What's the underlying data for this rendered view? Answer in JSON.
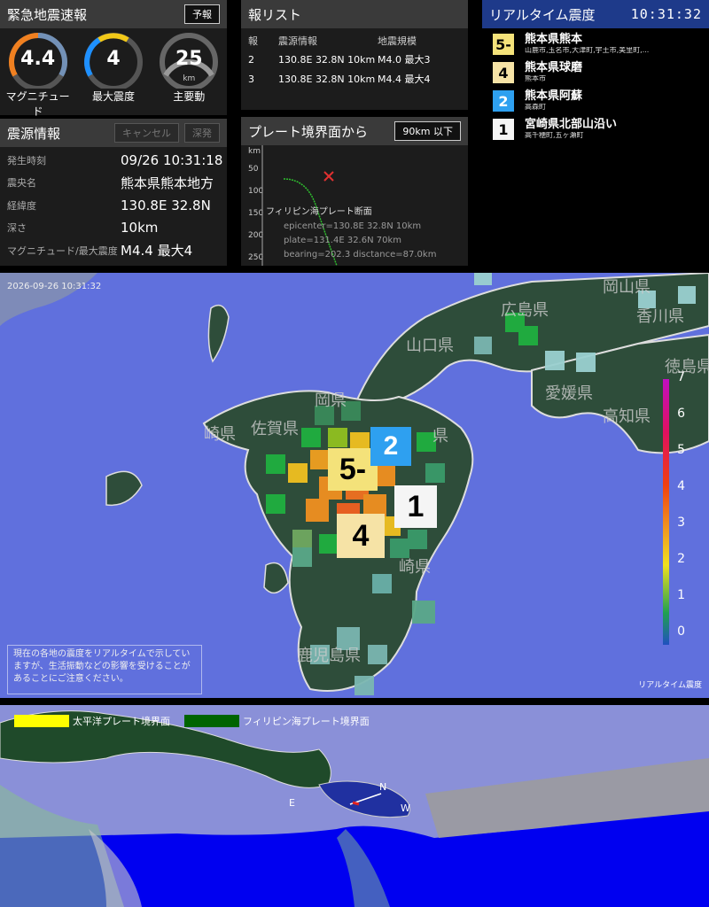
{
  "eew": {
    "title": "緊急地震速報",
    "forecast_button": "予報",
    "gauges": [
      {
        "value": "4.4",
        "unit": "",
        "label": "マグニチュード",
        "color": "#ffffff"
      },
      {
        "value": "4",
        "unit": "",
        "label": "最大震度",
        "color": "#ffffff"
      },
      {
        "value": "25",
        "unit": "km",
        "label": "主要動",
        "color": "#ffffff"
      }
    ]
  },
  "hypocenter": {
    "title": "震源情報",
    "cancel_button": "キャンセル",
    "deep_button": "深発",
    "rows": [
      {
        "key": "発生時刻",
        "value": "09/26 10:31:18"
      },
      {
        "key": "震央名",
        "value": "熊本県熊本地方"
      },
      {
        "key": "経緯度",
        "value": "130.8E 32.8N"
      },
      {
        "key": "深さ",
        "value": "10km"
      },
      {
        "key": "マグニチュード/最大震度",
        "value": "M4.4 最大4"
      }
    ]
  },
  "report_list": {
    "title": "報リスト",
    "headers": [
      "報",
      "震源情報",
      "地震規模"
    ],
    "rows": [
      {
        "num": "2",
        "source": "130.8E 32.8N 10km",
        "scale": "M4.0 最大3"
      },
      {
        "num": "3",
        "source": "130.8E 32.8N 10km",
        "scale": "M4.4 最大4"
      }
    ]
  },
  "plate": {
    "title": "プレート境界面から",
    "depth_button": "90km 以下",
    "y_unit": "km",
    "y_ticks": [
      "50",
      "100",
      "150",
      "200",
      "250"
    ],
    "section_label": "フィリピン海プレート断面",
    "lines": [
      "epicenter=130.8E 32.8N 10km",
      "plate=131.4E 32.6N 70km",
      "bearing=202.3 disctance=87.0km"
    ]
  },
  "realtime": {
    "title": "リアルタイム震度",
    "clock": "10:31:32",
    "items": [
      {
        "level": "5-",
        "color": "#f4e27a",
        "name": "熊本県熊本",
        "sub": "山鹿市,玉名市,大津町,宇土市,美里町,..."
      },
      {
        "level": "4",
        "color": "#f6e3a6",
        "name": "熊本県球磨",
        "sub": "熊本市"
      },
      {
        "level": "2",
        "color": "#2ea0f0",
        "name": "熊本県阿蘇",
        "sub": "高森町"
      },
      {
        "level": "1",
        "color": "#f5f5f5",
        "name": "宮崎県北部山沿い",
        "sub": "高千穂町,五ヶ瀬町"
      }
    ]
  },
  "map": {
    "timestamp": "2026-09-26 10:31:32",
    "note": "現在の各地の震度をリアルタイムで示していますが、生活振動などの影響を受けることがあることにご注意ください。",
    "scale_caption": "リアルタイム震度",
    "scale_labels": [
      "7",
      "6",
      "5",
      "4",
      "3",
      "2",
      "1",
      "0"
    ],
    "place_labels": [
      "山口県",
      "広島県",
      "岡山県",
      "香川県",
      "徳島県",
      "愛媛県",
      "高知県",
      "佐賀県",
      "崎県",
      "岡県",
      "県",
      "崎県",
      "鹿児島県"
    ],
    "pins": [
      {
        "level": "5-",
        "color": "#f4e27a"
      },
      {
        "level": "2",
        "color": "#2ea0f0"
      },
      {
        "level": "1",
        "color": "#f5f5f5"
      },
      {
        "level": "4",
        "color": "#f6e3a6"
      }
    ]
  },
  "view3d": {
    "legend_pacific": "太平洋プレート境界面",
    "legend_philippine": "フィリピン海プレート境界面",
    "pacific_color": "#ffff00",
    "philippine_color": "#006400",
    "compass": [
      "N",
      "E",
      "W"
    ]
  }
}
